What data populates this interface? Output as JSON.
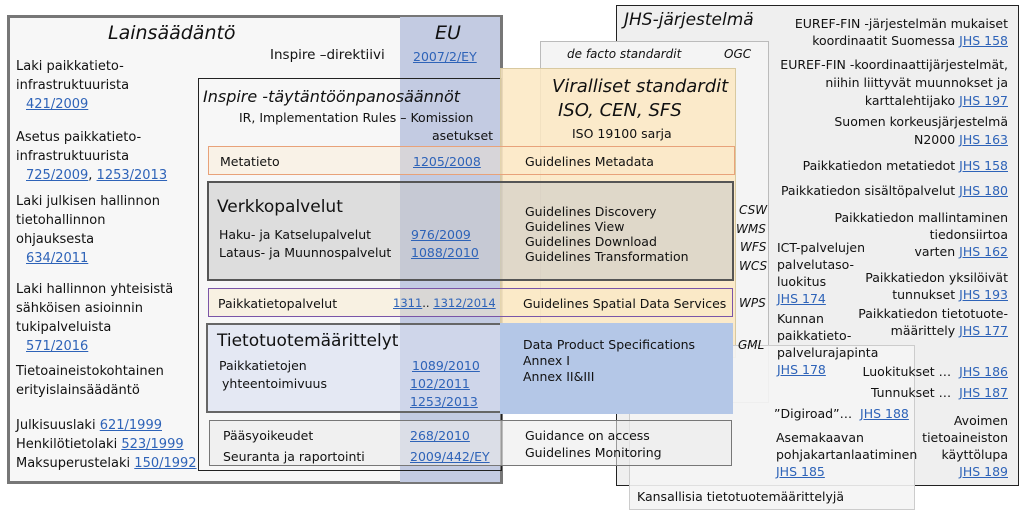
{
  "colors": {
    "eu": "#c3cbe2",
    "standards": "#fbe8c2",
    "jhs": "#efefef",
    "link": "#2e63b8",
    "data_product": "#b4c7e7"
  },
  "law": {
    "title": "Lainsäädäntö",
    "items": [
      {
        "lines": [
          "Laki paikkatieto-",
          "infrastruktuurista"
        ],
        "links": [
          "421/2009"
        ]
      },
      {
        "lines": [
          "Asetus paikkatieto-",
          "infrastruktuurista"
        ],
        "links": [
          "725/2009",
          "1253/2013"
        ]
      },
      {
        "lines": [
          "Laki julkisen hallinnon",
          "tietohallinnon",
          "ohjauksesta"
        ],
        "links": [
          "634/2011"
        ]
      },
      {
        "lines": [
          "Laki hallinnon yhteisistä",
          "sähköisen asioinnin",
          "tukipalveluista"
        ],
        "links": [
          "571/2016"
        ]
      },
      {
        "lines": [
          "Tietoaineistokohtainen",
          "erityislainsäädäntö"
        ],
        "links": []
      }
    ],
    "acts": [
      {
        "name": "Julkisuuslaki",
        "link": "621/1999"
      },
      {
        "name": "Henkilötietolaki",
        "link": "523/1999"
      },
      {
        "name": "Maksuperustelaki",
        "link": "150/1992"
      }
    ]
  },
  "eu": {
    "title": "EU",
    "directive_label": "Inspire –direktiivi",
    "directive_link": "2007/2/EY"
  },
  "inspire": {
    "title": "Inspire -täytäntöönpanosäännöt",
    "subtitle1": "IR, Implementation Rules  –  Komission",
    "subtitle2": "asetukset",
    "metadata": {
      "label": "Metatieto",
      "link": "1205/2008",
      "guideline": "Guidelines  Metadata"
    },
    "network": {
      "title": "Verkkopalvelut",
      "rows": [
        {
          "label": "Haku- ja Katselupalvelut",
          "link": "976/2009"
        },
        {
          "label": "Lataus- ja Muunnospalvelut",
          "link": "1088/2010"
        }
      ],
      "guidelines": [
        "Guidelines  Discovery",
        "Guidelines  View",
        "Guidelines  Download",
        "Guidelines  Transformation"
      ]
    },
    "spatial": {
      "label": "Paikkatietopalvelut",
      "link1": "1311",
      "sep": "..",
      "link2": "1312/2014",
      "guideline": "Guidelines  Spatial Data Services"
    },
    "dataspec": {
      "title": "Tietotuotemäärittelyt",
      "label1": "Paikkatietojen",
      "label2": "yhteentoimivuus",
      "links": [
        "1089/2010",
        "102/2011",
        "1253/2013"
      ],
      "guidelines": [
        "Data Product Specifications",
        "Annex I",
        "Annex II&III"
      ]
    },
    "access": {
      "rows": [
        {
          "label": "Pääsyoikeudet",
          "link": "268/2010"
        },
        {
          "label": "Seuranta ja raportointi",
          "link": "2009/442/EY"
        }
      ],
      "guidelines": [
        "Guidance on access",
        "Guidelines  Monitoring"
      ]
    }
  },
  "standards": {
    "title1": "Viralliset standardit",
    "title2": "ISO, CEN, SFS",
    "subtitle": "ISO 19100 sarja"
  },
  "defacto": {
    "title": "de facto standardit",
    "ogc": "OGC",
    "services": [
      "CSW",
      "WMS",
      "WFS",
      "WCS",
      "WPS",
      "GML"
    ]
  },
  "jhs": {
    "title": "JHS-järjestelmä",
    "items": [
      {
        "lines": [
          "EUREF-FIN -järjestelmän mukaiset",
          "koordinaatit Suomessa"
        ],
        "link": "JHS 158"
      },
      {
        "lines": [
          "EUREF-FIN -koordinaattijärjestelmät,",
          "niihin liittyvät muunnokset ja",
          "karttalehtijako"
        ],
        "link": "JHS 197"
      },
      {
        "lines": [
          "Suomen korkeusjärjestelmä",
          "N2000"
        ],
        "link": "JHS 163"
      },
      {
        "lines": [
          "Paikkatiedon metatiedot"
        ],
        "link": "JHS 158"
      },
      {
        "lines": [
          "Paikkatiedon sisältöpalvelut"
        ],
        "link": "JHS 180"
      },
      {
        "lines": [
          "Paikkatiedon mallintaminen",
          "tiedonsiirtoa",
          "varten"
        ],
        "link": "JHS 162"
      },
      {
        "lines": [
          "ICT-palvelujen",
          "palvelutaso-",
          "luokitus"
        ],
        "link": "JHS 174"
      },
      {
        "lines": [
          "Paikkatiedon yksilöivät",
          "tunnukset"
        ],
        "link": "JHS 193"
      },
      {
        "lines": [
          "Paikkatiedon tietotuote-",
          "määrittely"
        ],
        "link": "JHS 177"
      },
      {
        "lines": [
          "Kunnan",
          "paikkatieto-",
          "palvelurajapinta"
        ],
        "link": "JHS 178"
      },
      {
        "lines": [
          "Luokitukset …"
        ],
        "link": "JHS 186"
      },
      {
        "lines": [
          "Tunnukset …"
        ],
        "link": "JHS 187"
      },
      {
        "lines": [
          "”Digiroad”…"
        ],
        "link": "JHS 188"
      },
      {
        "lines": [
          "Asemakaavan",
          "pohjakartanlaatiminen"
        ],
        "link": "JHS 185"
      },
      {
        "lines": [
          "Avoimen",
          "tietoaineiston",
          "käyttölupa"
        ],
        "link": "JHS 189"
      }
    ],
    "national": "Kansallisia tietotuotemäärittelyjä"
  }
}
